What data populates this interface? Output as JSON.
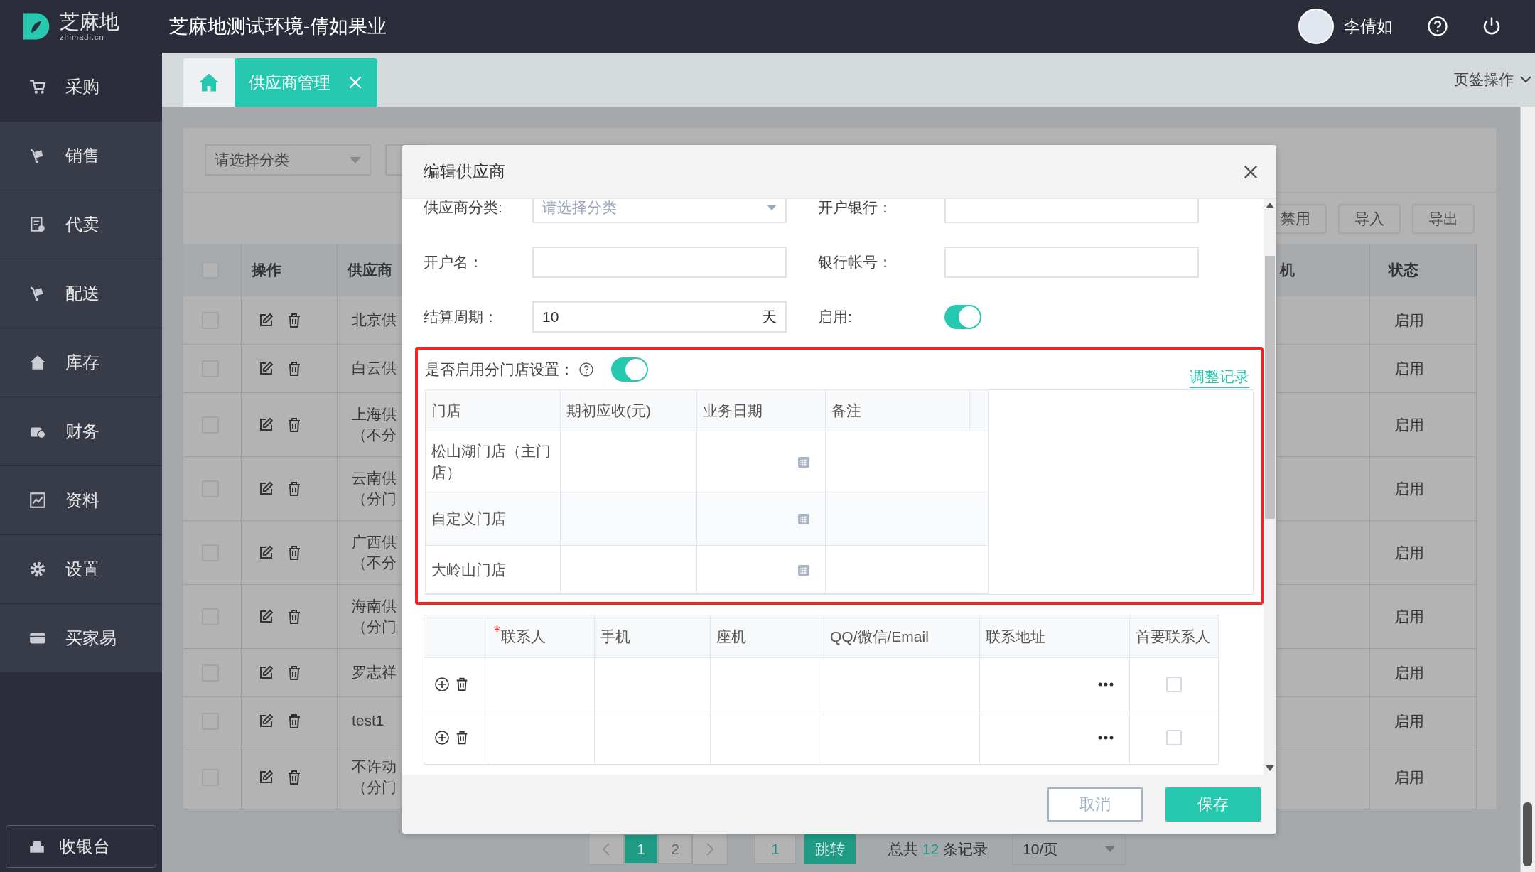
{
  "app": {
    "logo_text": "芝麻地",
    "logo_subtext": "zhimadi.cn",
    "title": "芝麻地测试环境-倩如果业",
    "user": "李倩如"
  },
  "sidebar": {
    "items": [
      {
        "label": "采购",
        "kind": "cart",
        "selected": true
      },
      {
        "label": "销售",
        "kind": "trolley",
        "selected": false
      },
      {
        "label": "代卖",
        "kind": "receipt",
        "selected": false
      },
      {
        "label": "配送",
        "kind": "trolley",
        "selected": false
      },
      {
        "label": "库存",
        "kind": "house",
        "selected": false
      },
      {
        "label": "财务",
        "kind": "money",
        "selected": false
      },
      {
        "label": "资料",
        "kind": "board",
        "selected": false
      },
      {
        "label": "设置",
        "kind": "gear",
        "selected": false
      },
      {
        "label": "买家易",
        "kind": "card",
        "selected": false
      }
    ],
    "bottom_button": "收银台"
  },
  "tabs": [
    {
      "kind": "home",
      "selected": false
    },
    {
      "kind": "page",
      "label": "供应商管理",
      "selected": true
    }
  ],
  "tab_actions": "页签操作",
  "background": {
    "filter_select": "请选择分类",
    "buttons": [
      "禁用",
      "导入",
      "导出"
    ],
    "columns": [
      "操作",
      "供应商",
      "机",
      "状态"
    ],
    "all_checked": false,
    "rows": [
      {
        "name": "北京供",
        "status": "启用",
        "checked": false
      },
      {
        "name": "白云供",
        "status": "启用",
        "checked": false
      },
      {
        "name": "上海供",
        "note": "（不分",
        "status": "启用",
        "checked": false
      },
      {
        "name": "云南供",
        "note": "（分门",
        "status": "启用",
        "checked": false
      },
      {
        "name": "广西供",
        "note": "（不分",
        "status": "启用",
        "checked": false
      },
      {
        "name": "海南供",
        "note": "（分门",
        "status": "启用",
        "checked": false
      },
      {
        "name": "罗志祥",
        "status": "启用",
        "checked": false
      },
      {
        "name": "test1",
        "status": "启用",
        "checked": false
      },
      {
        "name": "不许动",
        "note": "（分门",
        "status": "启用",
        "checked": false
      }
    ],
    "pagination": {
      "pages": [
        {
          "label": "1",
          "selected": true
        },
        {
          "label": "2",
          "selected": false
        }
      ],
      "jump_value": "1",
      "jump_button": "跳转",
      "total_prefix": "总共",
      "total": "12",
      "total_suffix": "条记录",
      "page_size": "10/页"
    }
  },
  "dialog": {
    "title": "编辑供应商",
    "fields": [
      {
        "label": "供应商分类:",
        "kind": "select",
        "placeholder": "请选择分类"
      },
      {
        "label": "开户银行：",
        "kind": "text"
      },
      {
        "label": "开户名：",
        "kind": "text"
      },
      {
        "label": "银行帐号：",
        "kind": "text"
      },
      {
        "label": "结算周期：",
        "kind": "number",
        "value": "10",
        "unit": "天"
      },
      {
        "label": "启用:",
        "kind": "switch",
        "on": true
      }
    ],
    "store_settings": {
      "label": "是否启用分门店设置：",
      "on": true,
      "link": "调整记录",
      "columns": [
        "门店",
        "期初应收(元)",
        "业务日期",
        "备注"
      ],
      "rows": [
        {
          "store": "松山湖门店（主门店）"
        },
        {
          "store": "自定义门店"
        },
        {
          "store": "大岭山门店"
        }
      ]
    },
    "contacts": {
      "columns": [
        {
          "label": "联系人",
          "required": true
        },
        {
          "label": "手机",
          "required": false
        },
        {
          "label": "座机",
          "required": false
        },
        {
          "label": "QQ/微信/Email",
          "required": false
        },
        {
          "label": "联系地址",
          "required": false
        },
        {
          "label": "首要联系人",
          "required": false
        }
      ],
      "rows": [
        {
          "primary": false
        },
        {
          "primary": false
        }
      ]
    },
    "buttons": [
      {
        "label": "取消",
        "kind": "secondary"
      },
      {
        "label": "保存",
        "kind": "primary"
      }
    ]
  }
}
